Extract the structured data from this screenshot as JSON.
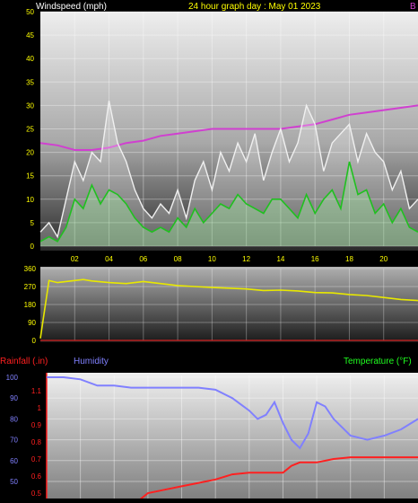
{
  "header": {
    "left_label": "Windspeed (mph)",
    "title": "24 hour graph day : May 01 2023",
    "right_label": "B"
  },
  "labels": {
    "rainfall": "Rainfall (.in)",
    "humidity": "Humidity",
    "temperature": "Temperature (°F)"
  },
  "colors": {
    "background": "#000000",
    "title": "#ffff00",
    "axis_text": "#ffff00",
    "barometer": "#d040d0",
    "gust": "#f0f0f0",
    "wind_avg": "#20c020",
    "wind_dir": "#e8e800",
    "rainfall": "#ff2020",
    "humidity": "#8080ff",
    "temperature": "#20ff20",
    "humidity_axis": "#8080ff"
  },
  "chart_data": [
    {
      "type": "line",
      "title": "24 hour graph day : May 01 2023",
      "ylabel": "Windspeed (mph)",
      "ylim": [
        0,
        50
      ],
      "xlim": [
        0,
        22
      ],
      "x_ticks": [
        "02",
        "04",
        "06",
        "08",
        "10",
        "12",
        "14",
        "16",
        "18",
        "20"
      ],
      "y_ticks": [
        "0",
        "5",
        "10",
        "15",
        "20",
        "25",
        "30",
        "35",
        "40",
        "45",
        "50"
      ],
      "grid": true,
      "series": [
        {
          "key": "barometer",
          "x": [
            0,
            1,
            2,
            3,
            4,
            5,
            6,
            7,
            8,
            9,
            10,
            11,
            12,
            13,
            14,
            15,
            16,
            17,
            18,
            19,
            20,
            21,
            22
          ],
          "values": [
            22,
            21.5,
            20.5,
            20.5,
            21,
            22,
            22.5,
            23.5,
            24,
            24.5,
            25,
            25,
            25,
            25,
            25,
            25.5,
            26,
            27,
            28,
            28.5,
            29,
            29.5,
            30
          ]
        },
        {
          "key": "gust",
          "x": [
            0,
            0.5,
            1,
            1.5,
            2,
            2.5,
            3,
            3.5,
            4,
            4.5,
            5,
            5.5,
            6,
            6.5,
            7,
            7.5,
            8,
            8.5,
            9,
            9.5,
            10,
            10.5,
            11,
            11.5,
            12,
            12.5,
            13,
            13.5,
            14,
            14.5,
            15,
            15.5,
            16,
            16.5,
            17,
            17.5,
            18,
            18.5,
            19,
            19.5,
            20,
            20.5,
            21,
            21.5,
            22
          ],
          "values": [
            3,
            5,
            2,
            10,
            18,
            14,
            20,
            18,
            31,
            22,
            18,
            12,
            8,
            6,
            9,
            7,
            12,
            6,
            14,
            18,
            12,
            20,
            16,
            22,
            18,
            24,
            14,
            20,
            25,
            18,
            22,
            30,
            26,
            16,
            22,
            24,
            26,
            18,
            24,
            20,
            18,
            12,
            16,
            8,
            10
          ]
        },
        {
          "key": "wind_avg",
          "x": [
            0,
            0.5,
            1,
            1.5,
            2,
            2.5,
            3,
            3.5,
            4,
            4.5,
            5,
            5.5,
            6,
            6.5,
            7,
            7.5,
            8,
            8.5,
            9,
            9.5,
            10,
            10.5,
            11,
            11.5,
            12,
            12.5,
            13,
            13.5,
            14,
            14.5,
            15,
            15.5,
            16,
            16.5,
            17,
            17.5,
            18,
            18.5,
            19,
            19.5,
            20,
            20.5,
            21,
            21.5,
            22
          ],
          "values": [
            1,
            2,
            1,
            4,
            10,
            8,
            13,
            9,
            12,
            11,
            9,
            6,
            4,
            3,
            4,
            3,
            6,
            4,
            8,
            5,
            7,
            9,
            8,
            11,
            9,
            8,
            7,
            10,
            10,
            8,
            6,
            11,
            7,
            10,
            12,
            8,
            18,
            11,
            12,
            7,
            9,
            5,
            8,
            4,
            3
          ]
        }
      ]
    },
    {
      "type": "line",
      "ylabel": "Wind direction",
      "ylim": [
        0,
        360
      ],
      "xlim": [
        0,
        22
      ],
      "y_ticks": [
        "0",
        "90",
        "180",
        "270",
        "360"
      ],
      "grid": true,
      "series": [
        {
          "key": "wind_dir",
          "x": [
            0,
            0.5,
            1,
            1.5,
            2,
            2.5,
            3,
            4,
            5,
            6,
            7,
            8,
            9,
            10,
            11,
            12,
            13,
            14,
            15,
            16,
            17,
            18,
            19,
            20,
            21,
            22
          ],
          "values": [
            10,
            300,
            290,
            295,
            300,
            305,
            298,
            290,
            285,
            295,
            285,
            275,
            270,
            265,
            262,
            258,
            250,
            252,
            248,
            240,
            238,
            230,
            225,
            215,
            205,
            200
          ]
        }
      ]
    },
    {
      "type": "line",
      "ylim_humidity": [
        0,
        100
      ],
      "ylim_rainfall": [
        0,
        1.2
      ],
      "y_ticks_humidity": [
        "50",
        "60",
        "70",
        "80",
        "90",
        "100"
      ],
      "y_ticks_rainfall": [
        "0.5",
        "0.6",
        "0.7",
        "0.8",
        "0.9",
        "1",
        "1.1"
      ],
      "xlim": [
        0,
        22
      ],
      "grid": true,
      "series": [
        {
          "key": "humidity",
          "x": [
            0,
            1,
            2,
            3,
            4,
            5,
            6,
            7,
            8,
            9,
            10,
            11,
            11.5,
            12,
            12.5,
            13,
            13.5,
            14,
            14.5,
            15,
            15.5,
            16,
            16.5,
            17,
            18,
            19,
            20,
            21,
            22
          ],
          "values": [
            100,
            100,
            99,
            96,
            96,
            95,
            95,
            95,
            95,
            95,
            94,
            90,
            87,
            84,
            80,
            82,
            88,
            78,
            70,
            66,
            73,
            88,
            86,
            80,
            72,
            70,
            72,
            75,
            80
          ]
        },
        {
          "key": "rainfall",
          "x": [
            0,
            5,
            5.5,
            6,
            7,
            8,
            9,
            10,
            11,
            12,
            13,
            14,
            14.5,
            15,
            16,
            17,
            18,
            19,
            20,
            21,
            22
          ],
          "values": [
            0.4,
            0.4,
            0.46,
            0.5,
            0.52,
            0.54,
            0.56,
            0.58,
            0.61,
            0.62,
            0.62,
            0.62,
            0.66,
            0.68,
            0.68,
            0.7,
            0.71,
            0.71,
            0.71,
            0.71,
            0.71
          ]
        }
      ]
    }
  ]
}
